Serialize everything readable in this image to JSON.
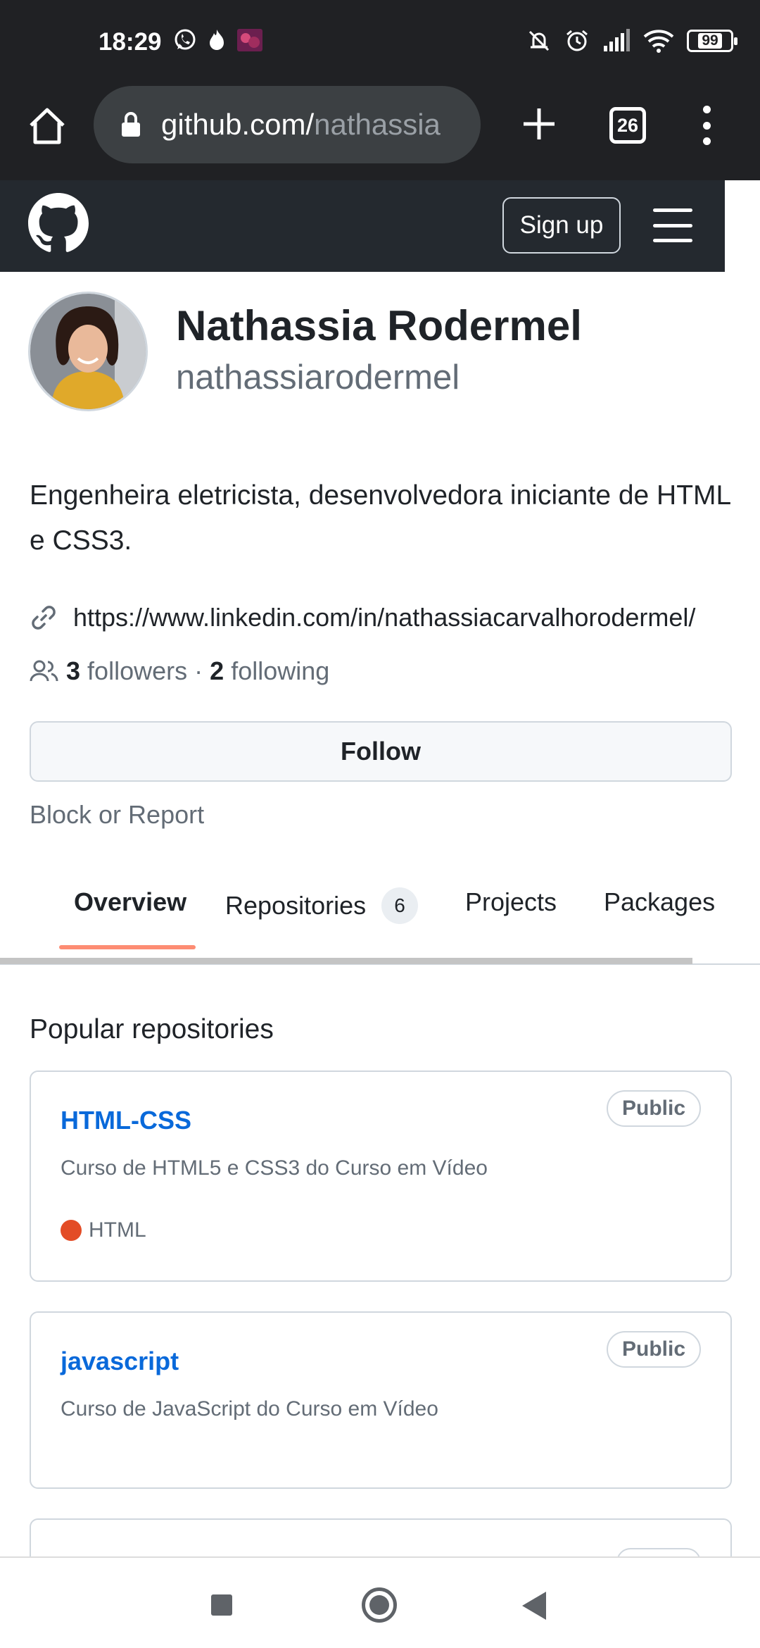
{
  "status_bar": {
    "time": "18:29",
    "left_icons": [
      "whatsapp-icon",
      "flame-icon",
      "app-thumbnail-icon"
    ],
    "right_icons": [
      "mute-bell-icon",
      "alarm-icon",
      "signal-icon",
      "wifi-icon"
    ],
    "battery": "99"
  },
  "browser": {
    "url_host": "github.com/",
    "url_path": "nathassia",
    "tab_count": "26",
    "icons": [
      "home-icon",
      "lock-icon",
      "plus-icon",
      "tabs-icon",
      "more-icon"
    ]
  },
  "github_header": {
    "signup_label": "Sign up",
    "icons": [
      "github-logo-icon",
      "hamburger-icon"
    ]
  },
  "profile": {
    "name": "Nathassia Rodermel",
    "login": "nathassiarodermel",
    "bio": "Engenheira eletricista, desenvolvedora iniciante de HTML e CSS3.",
    "link": "https://www.linkedin.com/in/nathassiacarvalhorodermel/",
    "followers_count": "3",
    "followers_label": "followers",
    "separator": "·",
    "following_count": "2",
    "following_label": "following",
    "follow_label": "Follow",
    "block_report_label": "Block or Report"
  },
  "tabs": [
    {
      "label": "Overview",
      "selected": true
    },
    {
      "label": "Repositories",
      "count": "6"
    },
    {
      "label": "Projects"
    },
    {
      "label": "Packages"
    }
  ],
  "popular": {
    "title": "Popular repositories",
    "repos": [
      {
        "name": "HTML-CSS",
        "visibility": "Public",
        "description": "Curso de HTML5 e CSS3 do Curso em Vídeo",
        "language": "HTML",
        "language_color": "#e34c26"
      },
      {
        "name": "javascript",
        "visibility": "Public",
        "description": "Curso de JavaScript do Curso em Vídeo"
      }
    ]
  },
  "colors": {
    "link_blue": "#0969da",
    "tab_underline": "#fd8c73",
    "header_bg": "#24292f",
    "chrome_bg": "#202124"
  },
  "nav_bar": {
    "icons": [
      "recents-icon",
      "home-nav-icon",
      "back-icon"
    ]
  }
}
